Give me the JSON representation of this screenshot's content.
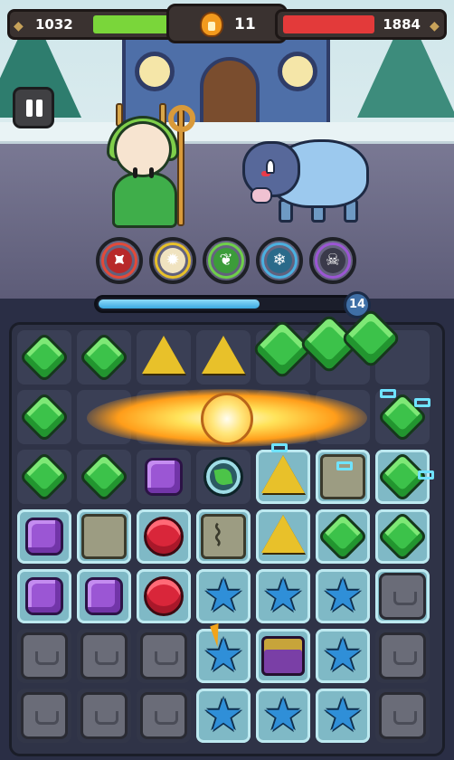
{
  "hud": {
    "player_hp": "1032",
    "enemy_hp": "1884",
    "player_hp_fraction": 0.5,
    "enemy_hp_fraction": 0.55,
    "turns": "11",
    "turn_icon": "fire-potion-icon"
  },
  "pause": {
    "icon": "pause-icon"
  },
  "characters": {
    "hero": "forest-druid-girl",
    "enemy": "ice-boar"
  },
  "skills": [
    {
      "icon": "red-bird-icon",
      "ring_color": "#e24a3a",
      "core_color": "#b8292a",
      "glyph": "⯍"
    },
    {
      "icon": "fire-phoenix-icon",
      "ring_color": "#e8c12a",
      "core_color": "#f0e3c0",
      "glyph": "✹"
    },
    {
      "icon": "green-leaf-icon",
      "ring_color": "#6fcf4a",
      "core_color": "#3c9c3a",
      "glyph": "❦"
    },
    {
      "icon": "ice-crystal-icon",
      "ring_color": "#4bb0e0",
      "core_color": "#2a6a8a",
      "glyph": "❄"
    },
    {
      "icon": "skull-curse-icon",
      "ring_color": "#9b56d4",
      "core_color": "#3a3a4a",
      "glyph": "☠"
    }
  ],
  "progress": {
    "fraction": 0.64,
    "level": "14"
  },
  "colors": {
    "green_gem": "#3cc24a",
    "yellow_gem": "#e8c12a",
    "purple_gem": "#9b56d4",
    "red_gem": "#d9263a",
    "blue_gem": "#2f8fd8",
    "hp_player": "#7ad63a",
    "hp_enemy": "#e33a3a"
  },
  "board": {
    "cols": 7,
    "rows": 7,
    "cells": [
      [
        "green",
        "green",
        "yellow",
        "yellow",
        "none",
        "none",
        "none"
      ],
      [
        "green",
        "none",
        "none",
        "none",
        "none",
        "none",
        "green"
      ],
      [
        "green",
        "green",
        "purple",
        "leaf",
        "yellow",
        "stone",
        "green"
      ],
      [
        "purple",
        "stone",
        "red",
        "cracked",
        "yellow",
        "green",
        "green"
      ],
      [
        "purple",
        "purple",
        "red",
        "blue",
        "blue",
        "blue",
        "locked"
      ],
      [
        "locked",
        "locked",
        "locked",
        "blue",
        "chest",
        "blue",
        "locked"
      ],
      [
        "locked",
        "locked",
        "locked",
        "blue",
        "blue",
        "blue",
        "locked"
      ]
    ],
    "ice": [
      [
        false,
        false,
        false,
        false,
        false,
        false,
        false
      ],
      [
        false,
        false,
        false,
        false,
        false,
        false,
        false
      ],
      [
        false,
        false,
        false,
        false,
        true,
        true,
        true
      ],
      [
        true,
        true,
        true,
        true,
        true,
        true,
        true
      ],
      [
        true,
        true,
        true,
        true,
        true,
        true,
        true
      ],
      [
        false,
        false,
        false,
        true,
        true,
        true,
        false
      ],
      [
        false,
        false,
        false,
        true,
        true,
        true,
        false
      ]
    ]
  }
}
